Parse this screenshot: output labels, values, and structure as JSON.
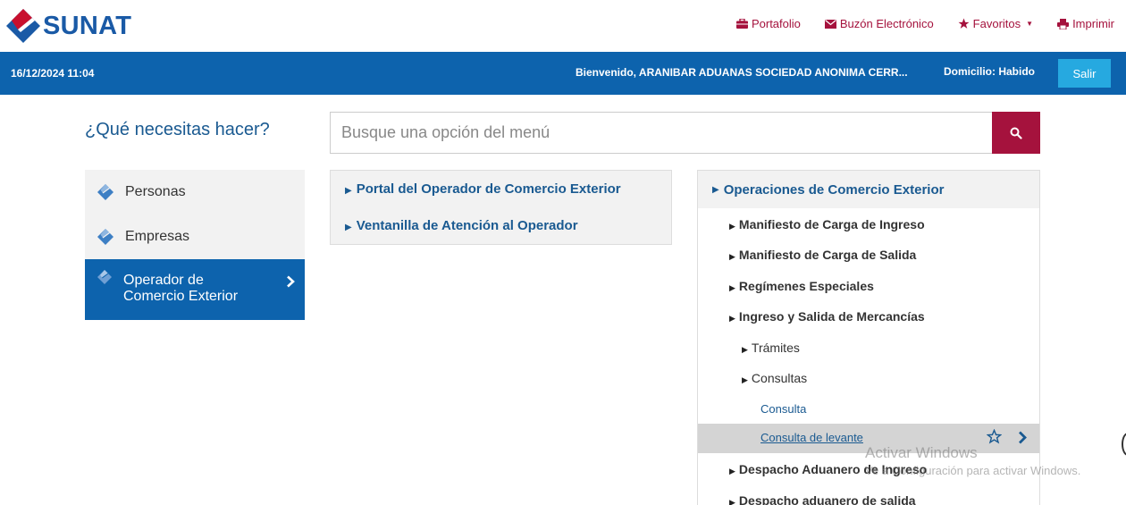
{
  "header": {
    "brand": "SUNAT",
    "nav": [
      {
        "label": "Portafolio",
        "icon": "briefcase-icon"
      },
      {
        "label": "Buzón Electrónico",
        "icon": "envelope-icon"
      },
      {
        "label": "Favoritos",
        "icon": "star-icon"
      },
      {
        "label": "Imprimir",
        "icon": "printer-icon"
      }
    ]
  },
  "infobar": {
    "datetime": "16/12/2024 11:04",
    "welcome": "Bienvenido, ARANIBAR ADUANAS SOCIEDAD ANONIMA CERR...",
    "domicilio": "Domicilio: Habido",
    "logout": "Salir"
  },
  "main": {
    "question": "¿Qué necesitas hacer?",
    "search_placeholder": "Busque una opción del menú"
  },
  "left_menu": {
    "items": [
      {
        "label": "Personas",
        "active": false
      },
      {
        "label": "Empresas",
        "active": false
      },
      {
        "label": "Operador de Comercio Exterior",
        "active": true
      }
    ]
  },
  "middle_menu": {
    "items": [
      "Portal del Operador de Comercio Exterior",
      "Ventanilla de Atención al Operador"
    ]
  },
  "right_menu": {
    "title": "Operaciones de Comercio Exterior",
    "items": [
      "Manifiesto de Carga de Ingreso",
      "Manifiesto de Carga de Salida",
      "Regímenes Especiales",
      "Ingreso y Salida de Mercancías"
    ],
    "subitems": [
      "Trámites",
      "Consultas"
    ],
    "leaf": "Consulta",
    "selected_leaf": "Consulta de levante",
    "after_items": [
      "Despacho Aduanero de Ingreso",
      "Despacho aduanero de salida"
    ]
  },
  "watermark": {
    "line1": "Activar Windows",
    "line2": "Ve a Configuración para activar Windows."
  },
  "colors": {
    "brand_blue": "#0d63ad",
    "accent_red": "#a5123d",
    "logout_cyan": "#26a9e0"
  }
}
